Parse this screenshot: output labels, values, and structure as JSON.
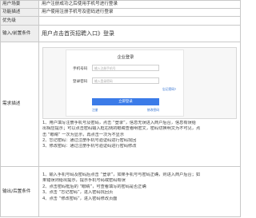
{
  "rows": [
    {
      "label": "用户场景",
      "value": "用户注册成功之后使用手机号进行登录"
    },
    {
      "label": "功能描述",
      "value": "用户使用注册手机号及密码进行登录"
    },
    {
      "label": "优先级",
      "value": ""
    },
    {
      "label": "输入/前置条件",
      "value": "用户点击首页招聘入口》登录"
    }
  ],
  "desc_label": "需求描述",
  "post_label": "输出/后置条件",
  "login_form": {
    "title": "企业登录",
    "phone_label": "手机号码",
    "phone_placeholder": "输入注册手机号",
    "password_label": "登录密码",
    "password_placeholder": "输入登录密码",
    "forgot_link": "忘记密码?",
    "login_button": "立即登录",
    "register_link": "注册",
    "change_password_link": "修改密码"
  },
  "description_lines": [
    "1、用户填写注册手机号及密码，点击 “登录”，信息无误进入商户后台，信息有误给",
    "出相应提示；可以点击密码输入框右侧的眼睛查看明密文，密码切换明文为不可见，点",
    "击 “眼睛” 一次为显示，再点击一次为不显示",
    "2、忘记密码：通过注册手机号验证码进行密码找回",
    "3、修改密码：通过注册手机号验证码进行密码修改"
  ],
  "post_lines": [
    "1、输入手机号码及密码后点击 “登录”，如果手机号与密码正确，则进入商户后台；如",
    "果错误则给出提示，提示手机号码或密码有误",
    "2、点击密码框后的 “眼睛”，可查看填写的密码是否正确",
    "3、点击 “忘记密码”，进入密码找回页",
    "4、点击 “修改密码”，进入密码修改页面"
  ]
}
